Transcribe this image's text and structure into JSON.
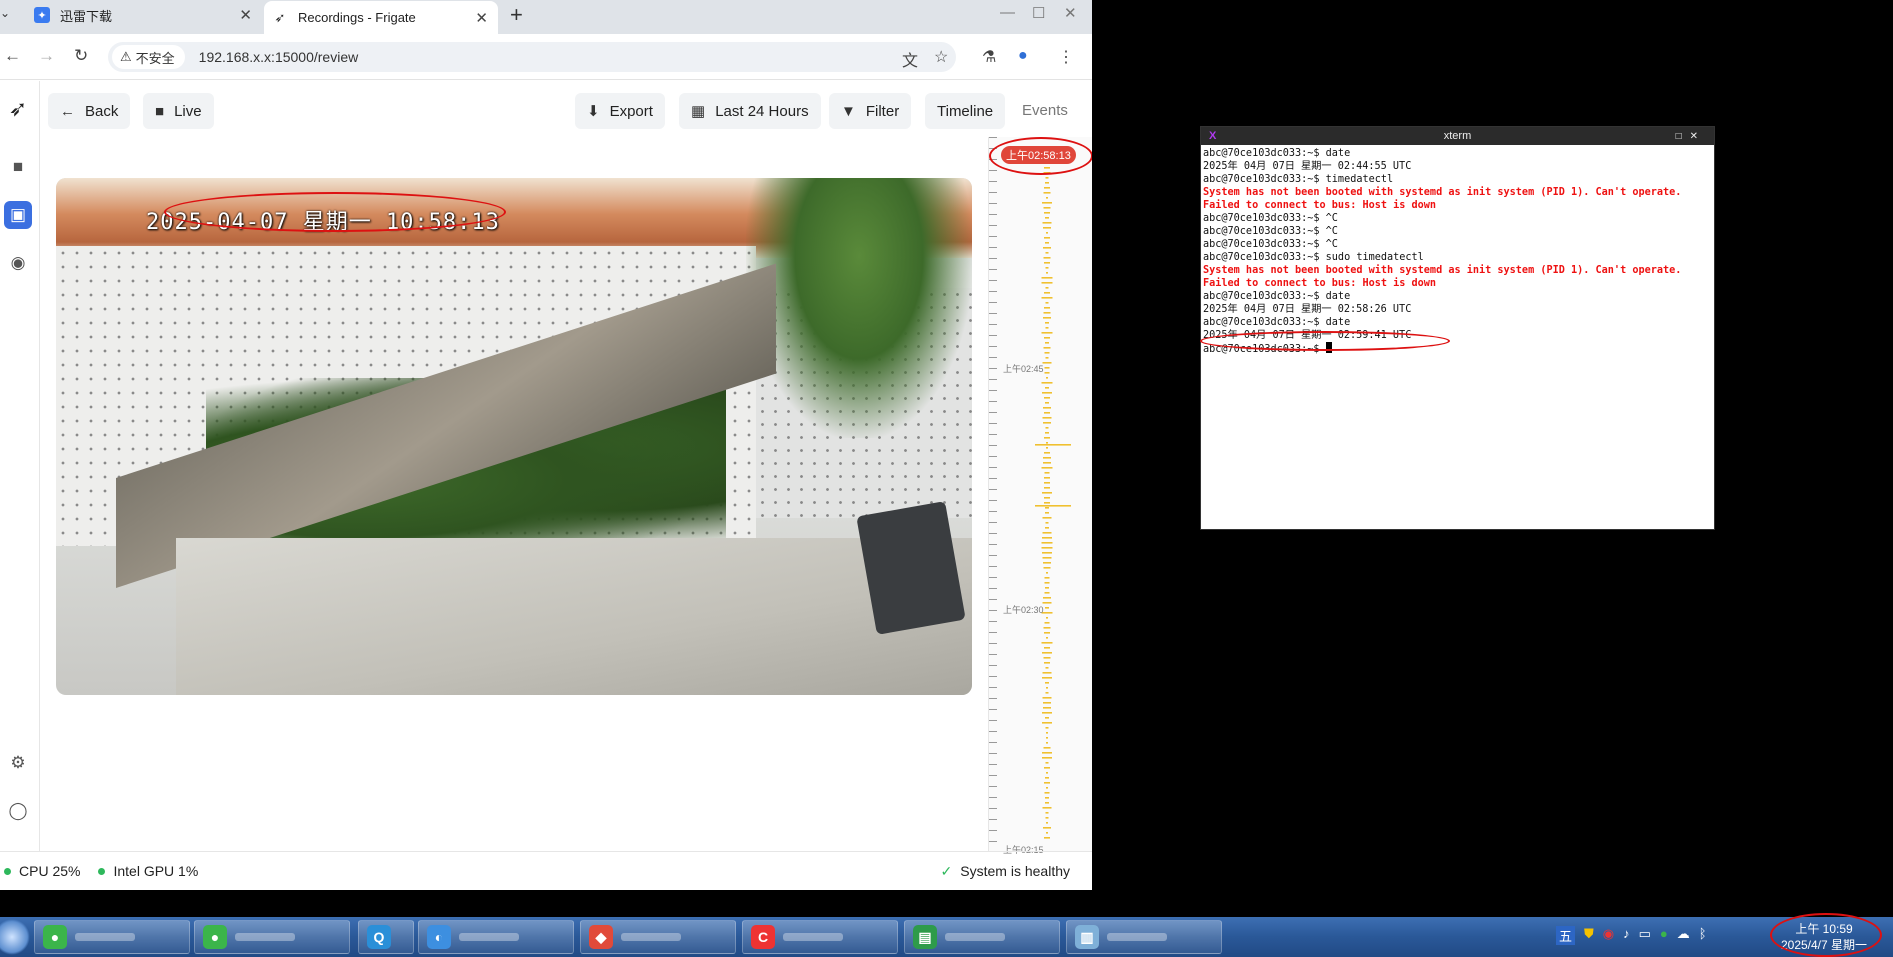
{
  "browser": {
    "tabs": [
      {
        "title": "迅雷下载",
        "favicon": "thunder-icon"
      },
      {
        "title": "Recordings - Frigate",
        "favicon": "frigate-bird-icon"
      }
    ],
    "security_label": "不安全",
    "url": "192.168.x.x:15000/review"
  },
  "toolbar": {
    "back_label": "Back",
    "live_label": "Live",
    "export_label": "Export",
    "range_label": "Last 24 Hours",
    "filter_label": "Filter",
    "timeline_label": "Timeline",
    "events_label": "Events"
  },
  "video": {
    "osd_timestamp": "2025-04-07 星期一 10:58:13"
  },
  "timeline": {
    "current_time": "上午02:58:13",
    "labels": [
      "上午02:45",
      "上午02:30",
      "上午02:15"
    ]
  },
  "status": {
    "cpu": "CPU 25%",
    "gpu": "Intel GPU 1%",
    "health": "System is healthy"
  },
  "xterm": {
    "title": "xterm",
    "lines": [
      {
        "text": "abc@70ce103dc033:~$ date",
        "type": "normal"
      },
      {
        "text": "2025年 04月 07日 星期一 02:44:55 UTC",
        "type": "normal"
      },
      {
        "text": "abc@70ce103dc033:~$ timedatectl",
        "type": "normal"
      },
      {
        "text": "System has not been booted with systemd as init system (PID 1). Can't operate.",
        "type": "error"
      },
      {
        "text": "Failed to connect to bus: Host is down",
        "type": "error"
      },
      {
        "text": "abc@70ce103dc033:~$ ^C",
        "type": "normal"
      },
      {
        "text": "abc@70ce103dc033:~$ ^C",
        "type": "normal"
      },
      {
        "text": "abc@70ce103dc033:~$ ^C",
        "type": "normal"
      },
      {
        "text": "abc@70ce103dc033:~$ sudo timedatectl",
        "type": "normal"
      },
      {
        "text": "System has not been booted with systemd as init system (PID 1). Can't operate.",
        "type": "error"
      },
      {
        "text": "Failed to connect to bus: Host is down",
        "type": "error"
      },
      {
        "text": "abc@70ce103dc033:~$ date",
        "type": "normal"
      },
      {
        "text": "2025年 04月 07日 星期一 02:58:26 UTC",
        "type": "normal"
      },
      {
        "text": "abc@70ce103dc033:~$ date",
        "type": "normal"
      },
      {
        "text": "2025年 04月 07日 星期一 02:59:41 UTC",
        "type": "normal"
      },
      {
        "text": "abc@70ce103dc033:~$ ",
        "type": "prompt"
      }
    ]
  },
  "taskbar": {
    "clock_time": "上午 10:59",
    "clock_date": "2025/4/7 星期一",
    "ime_label": "五"
  }
}
